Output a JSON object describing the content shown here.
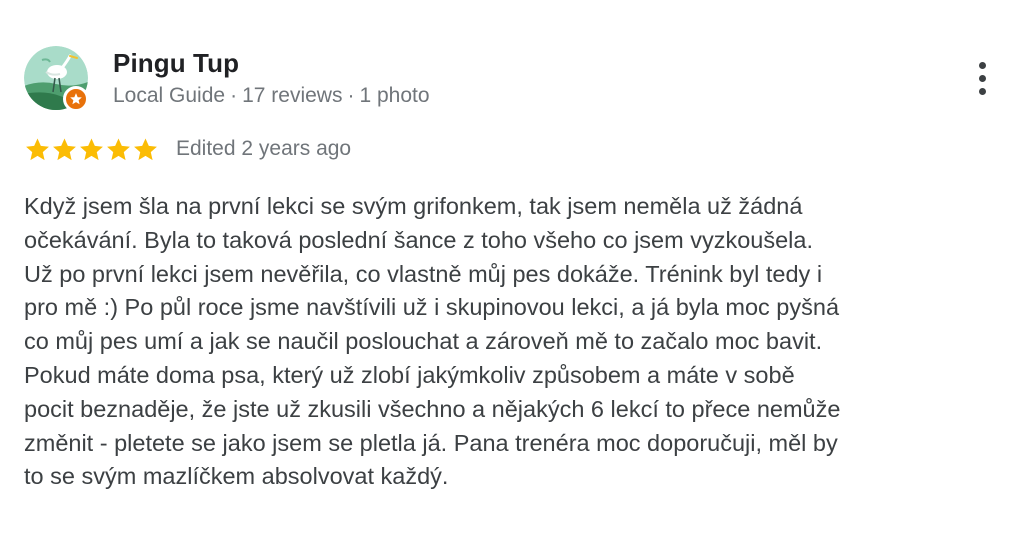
{
  "reviewer": {
    "name": "Pingu Tup",
    "badge": "Local Guide",
    "reviews": "17 reviews",
    "photos": "1 photo",
    "avatar_icon": "heron-avatar-icon",
    "badge_icon": "local-guide-star-icon"
  },
  "rating": {
    "stars": 5,
    "max": 5,
    "star_color": "#fbbc04",
    "edited": "Edited 2 years ago"
  },
  "menu": {
    "icon": "more-vert-icon"
  },
  "review": {
    "lines": [
      "Když jsem šla na první lekci se svým grifonkem, tak jsem neměla už žádná",
      "očekávání. Byla to taková poslední šance z toho všeho co jsem vyzkoušela.",
      "Už po první lekci jsem nevěřila, co vlastně můj pes dokáže. Trénink byl tedy i",
      "pro mě :) Po půl roce jsme navštívili už i skupinovou lekci, a já byla moc pyšná",
      "co můj pes umí a jak se naučil poslouchat a zároveň mě to začalo moc bavit.",
      "Pokud máte doma psa, který už zlobí jakýmkoliv způsobem a máte v sobě",
      "pocit beznaděje, že jste už zkusili všechno a nějakých 6 lekcí to přece nemůže",
      "změnit - pletete se jako jsem se pletla já. Pana trenéra moc doporučuji, měl by",
      "to se svým mazlíčkem absolvovat každý."
    ]
  },
  "colors": {
    "name": "#202124",
    "meta": "#70757a",
    "body_text": "#3c4043",
    "badge": "#e8710a",
    "star": "#fbbc04"
  }
}
